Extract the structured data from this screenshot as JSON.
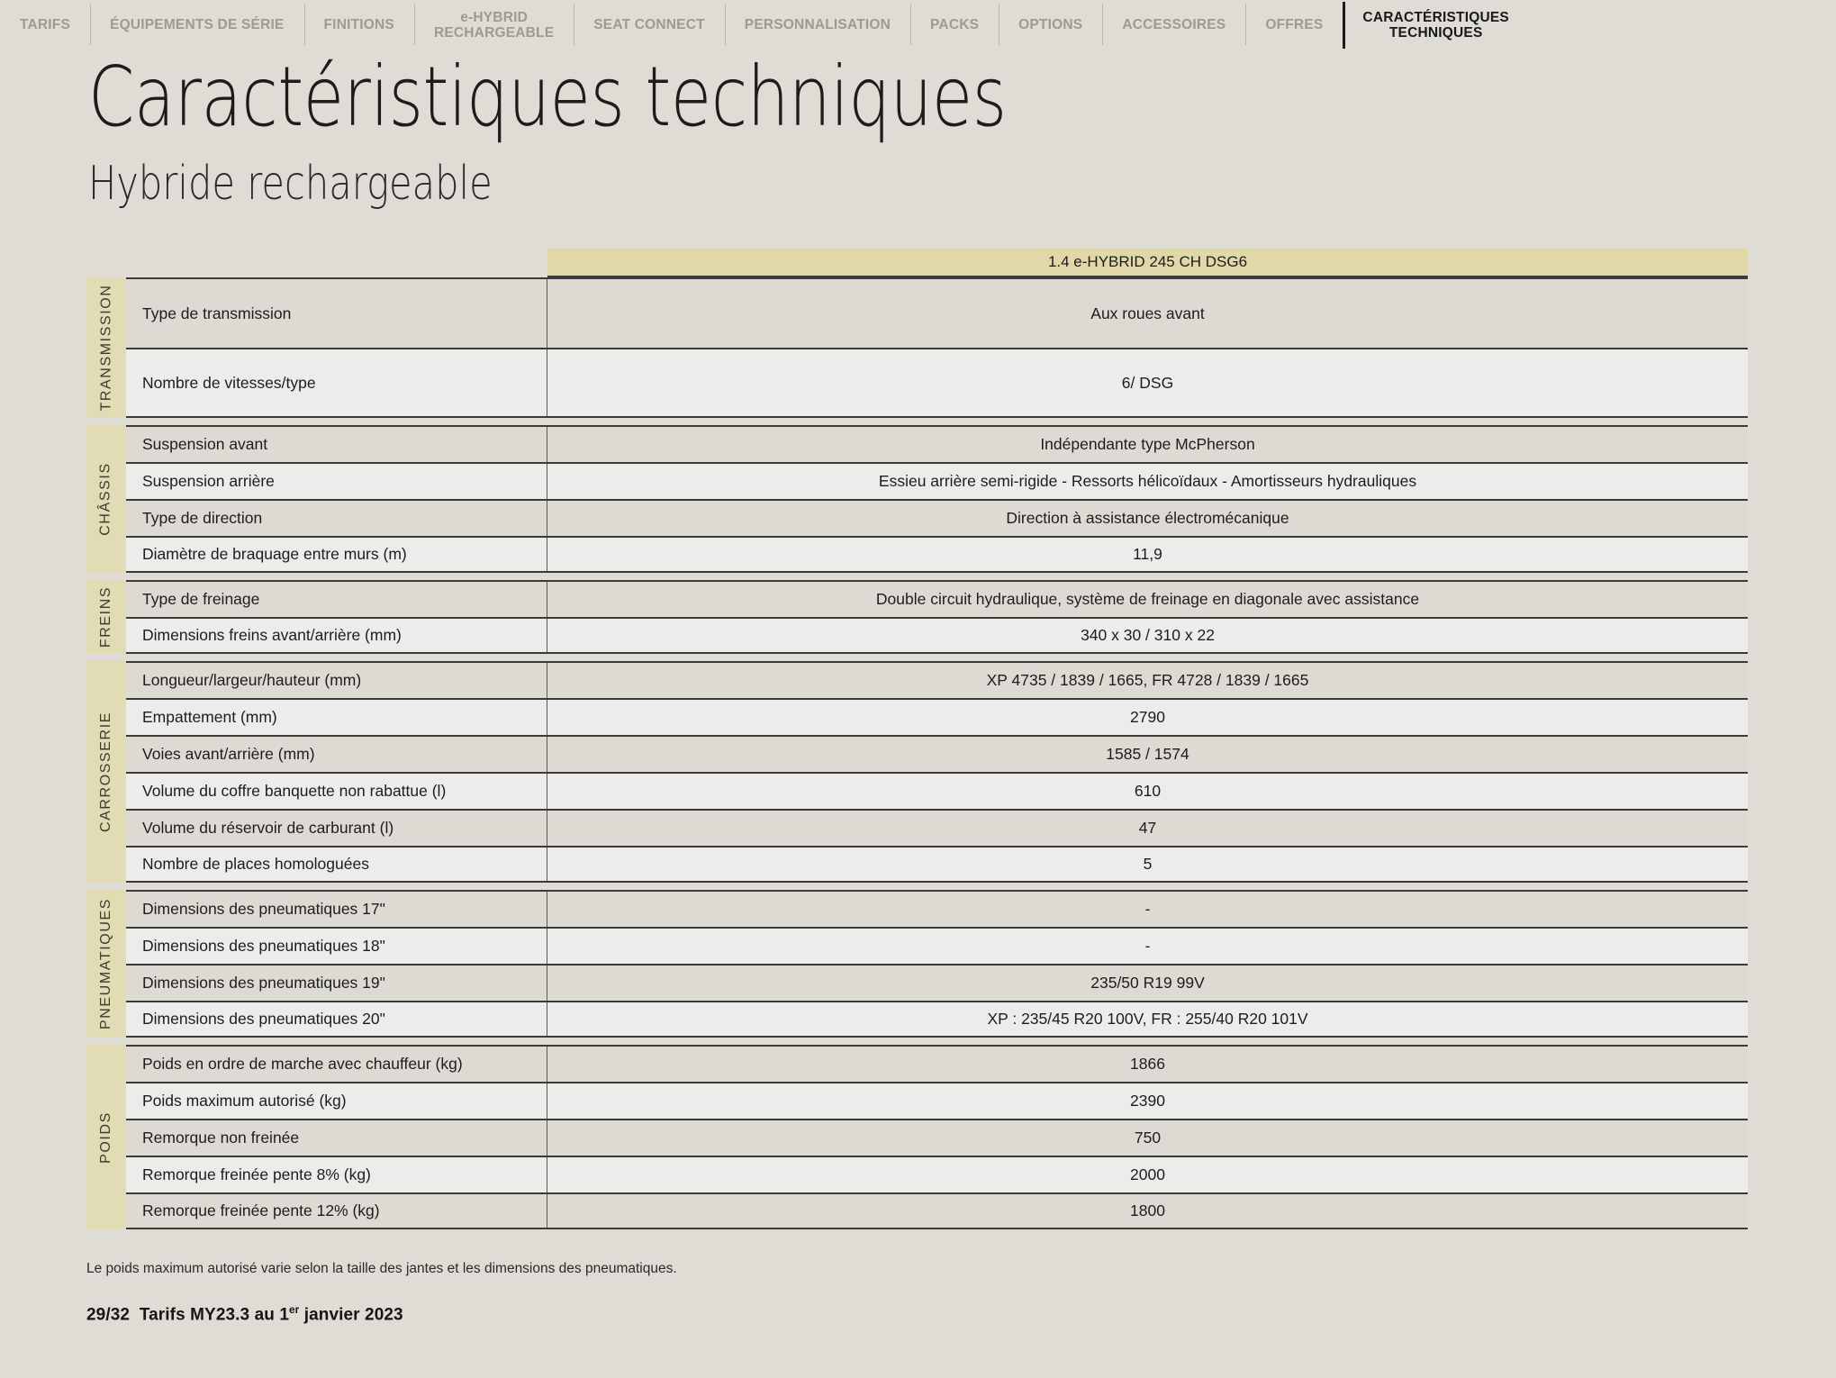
{
  "nav": {
    "items": [
      {
        "label": "TARIFS",
        "active": false
      },
      {
        "label": "ÉQUIPEMENTS DE SÉRIE",
        "active": false
      },
      {
        "label": "FINITIONS",
        "active": false
      },
      {
        "label": "e-HYBRID\nRECHARGEABLE",
        "active": false
      },
      {
        "label": "SEAT CONNECT",
        "active": false
      },
      {
        "label": "PERSONNALISATION",
        "active": false
      },
      {
        "label": "PACKS",
        "active": false
      },
      {
        "label": "OPTIONS",
        "active": false
      },
      {
        "label": "ACCESSOIRES",
        "active": false
      },
      {
        "label": "OFFRES",
        "active": false
      },
      {
        "label": "CARACTÉRISTIQUES\nTECHNIQUES",
        "active": true
      }
    ]
  },
  "heading": {
    "title": "Caractéristiques techniques",
    "subtitle": "Hybride rechargeable"
  },
  "table": {
    "column_header": "1.4 e-HYBRID 245 CH DSG6",
    "sections": [
      {
        "category": "TRANSMISSION",
        "tall": true,
        "rows": [
          {
            "label": "Type de transmission",
            "value": "Aux roues avant"
          },
          {
            "label": "Nombre de vitesses/type",
            "value": "6/ DSG"
          }
        ]
      },
      {
        "category": "CHÂSSIS",
        "tall": false,
        "rows": [
          {
            "label": "Suspension avant",
            "value": "Indépendante type McPherson"
          },
          {
            "label": "Suspension arrière",
            "value": "Essieu arrière semi-rigide - Ressorts hélicoïdaux - Amortisseurs hydrauliques"
          },
          {
            "label": "Type de direction",
            "value": "Direction à assistance électromécanique"
          },
          {
            "label": "Diamètre de braquage entre murs (m)",
            "value": "11,9"
          }
        ]
      },
      {
        "category": "FREINS",
        "tall": false,
        "rows": [
          {
            "label": "Type de freinage",
            "value": "Double circuit hydraulique, système de freinage en diagonale avec assistance"
          },
          {
            "label": "Dimensions freins avant/arrière (mm)",
            "value": "340 x 30 / 310 x 22"
          }
        ]
      },
      {
        "category": "CARROSSERIE",
        "tall": false,
        "rows": [
          {
            "label": "Longueur/largeur/hauteur (mm)",
            "value": "XP 4735 / 1839 / 1665, FR 4728 / 1839 / 1665"
          },
          {
            "label": "Empattement (mm)",
            "value": "2790"
          },
          {
            "label": "Voies avant/arrière (mm)",
            "value": "1585 / 1574"
          },
          {
            "label": "Volume du coffre banquette non rabattue (l)",
            "value": "610"
          },
          {
            "label": "Volume du réservoir de carburant (l)",
            "value": "47"
          },
          {
            "label": "Nombre de places homologuées",
            "value": "5"
          }
        ]
      },
      {
        "category": "PNEUMATIQUES",
        "tall": false,
        "rows": [
          {
            "label": "Dimensions des pneumatiques 17\"",
            "value": "-"
          },
          {
            "label": "Dimensions des pneumatiques 18\"",
            "value": "-"
          },
          {
            "label": "Dimensions des pneumatiques 19\"",
            "value": "235/50 R19 99V"
          },
          {
            "label": "Dimensions des pneumatiques 20\"",
            "value": "XP : 235/45 R20 100V, FR : 255/40 R20 101V"
          }
        ]
      },
      {
        "category": "POIDS",
        "tall": false,
        "rows": [
          {
            "label": "Poids en ordre de marche avec chauffeur (kg)",
            "value": "1866"
          },
          {
            "label": "Poids maximum autorisé (kg)",
            "value": "2390"
          },
          {
            "label": "Remorque non freinée",
            "value": "750"
          },
          {
            "label": "Remorque freinée pente 8% (kg)",
            "value": "2000"
          },
          {
            "label": "Remorque freinée pente 12% (kg)",
            "value": "1800"
          }
        ]
      }
    ]
  },
  "footer": {
    "note": "Le poids maximum autorisé varie selon la taille des jantes et les dimensions des pneumatiques.",
    "page_prefix": "29/32",
    "tariff_a": "Tarifs MY23.3 au 1",
    "tariff_sup": "er",
    "tariff_b": "janvier 2023"
  },
  "colors": {
    "page_background": "#dedcd4",
    "column_header_gold": "#e0d8a8",
    "category_band": "#e2dcb4",
    "row_shade_a": "#dcdad3",
    "row_shade_b": "#ececea",
    "rule": "#3a3a36",
    "nav_inactive": "#9d9a92",
    "nav_active": "#19191a"
  }
}
